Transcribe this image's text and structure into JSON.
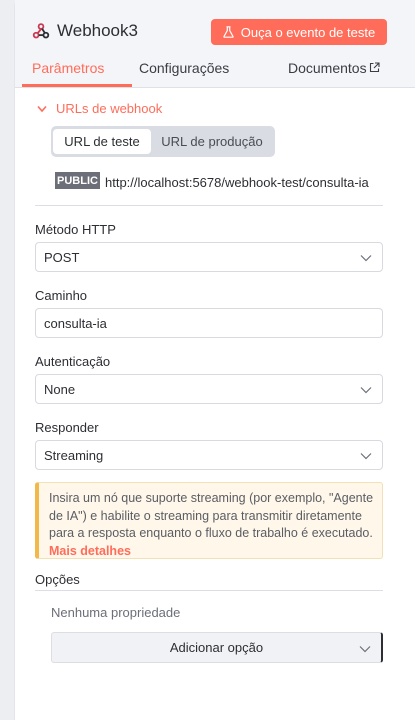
{
  "header": {
    "title": "Webhook3",
    "test_button_label": "Ouça o evento de teste",
    "node_icon": "webhook-icon",
    "test_icon": "flask-icon"
  },
  "tabs": [
    {
      "label": "Parâmetros",
      "active": true
    },
    {
      "label": "Configurações",
      "active": false
    },
    {
      "label": "Documentos",
      "active": false,
      "icon": "external-link-icon"
    }
  ],
  "webhook_urls": {
    "section_label": "URLs de webhook",
    "toggle_test": "URL de teste",
    "toggle_production": "URL de produção",
    "selected": "URL de teste",
    "badge": "PUBLIC",
    "url": "http://localhost:5678/webhook-test/consulta-ia"
  },
  "fields": {
    "http_method": {
      "label": "Método HTTP",
      "value": "POST"
    },
    "path": {
      "label": "Caminho",
      "value": "consulta-ia"
    },
    "authentication": {
      "label": "Autenticação",
      "value": "None"
    },
    "respond": {
      "label": "Responder",
      "value": "Streaming"
    }
  },
  "notice": {
    "text": "Insira um nó que suporte streaming (por exemplo, \"Agente de IA\") e habilite o streaming para transmitir diretamente para a resposta enquanto o fluxo de trabalho é executado.",
    "link": "Mais detalhes"
  },
  "options": {
    "title": "Opções",
    "empty": "Nenhuma propriedade",
    "add_button": "Adicionar opção"
  },
  "colors": {
    "accent": "#ff6d5a",
    "notice_border": "#f0b94a",
    "notice_bg": "#fef7ea"
  }
}
